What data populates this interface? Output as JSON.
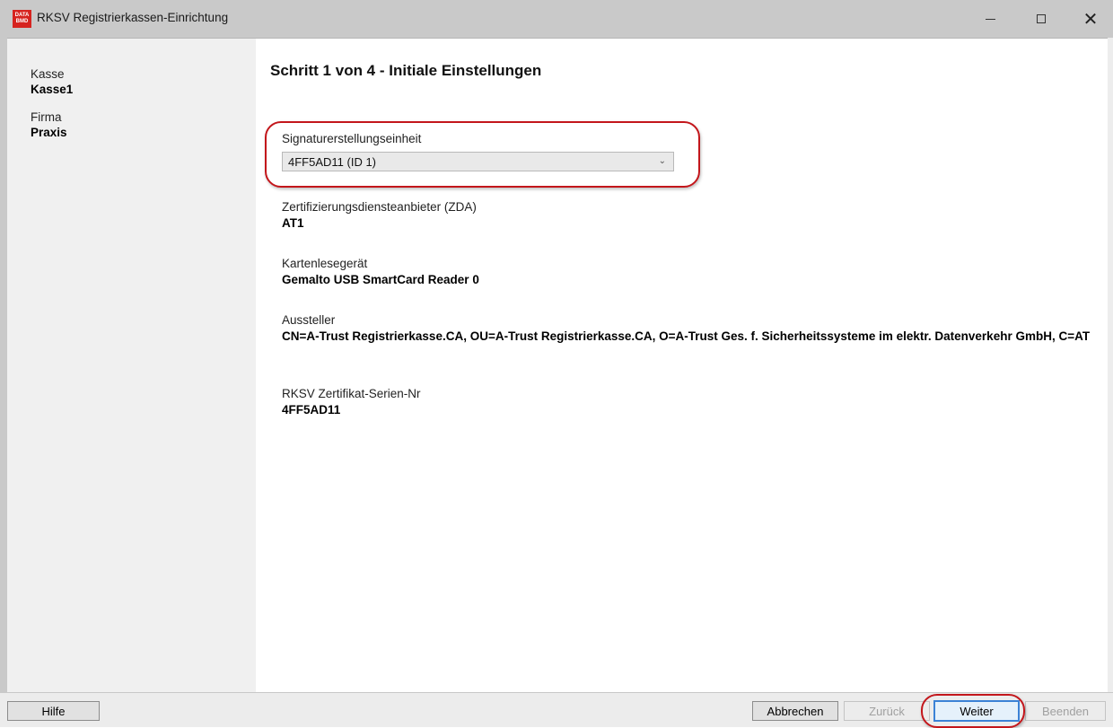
{
  "window": {
    "title": "RKSV Registrierkassen-Einrichtung",
    "logo_text_top": "DATA",
    "logo_text_bottom": "BMD"
  },
  "sidebar": {
    "kasse_label": "Kasse",
    "kasse_value": "Kasse1",
    "firma_label": "Firma",
    "firma_value": "Praxis"
  },
  "main": {
    "step_title": "Schritt 1 von 4 - Initiale Einstellungen",
    "sig_label": "Signaturerstellungseinheit",
    "sig_selected": "4FF5AD11  (ID 1)",
    "zda_label": "Zertifizierungsdiensteanbieter (ZDA)",
    "zda_value": "AT1",
    "reader_label": "Kartenlesegerät",
    "reader_value": "Gemalto USB SmartCard Reader 0",
    "issuer_label": "Aussteller",
    "issuer_value": "CN=A-Trust Registrierkasse.CA, OU=A-Trust Registrierkasse.CA, O=A-Trust Ges. f. Sicherheitssysteme im elektr. Datenverkehr GmbH, C=AT",
    "serial_label": "RKSV Zertifikat-Serien-Nr",
    "serial_value": "4FF5AD11"
  },
  "buttons": {
    "hilfe": "Hilfe",
    "abbrechen": "Abbrechen",
    "zurueck": "Zurück",
    "weiter": "Weiter",
    "beenden": "Beenden"
  },
  "colors": {
    "highlight_ellipse": "#c3161b",
    "logo_red": "#d6231f"
  }
}
